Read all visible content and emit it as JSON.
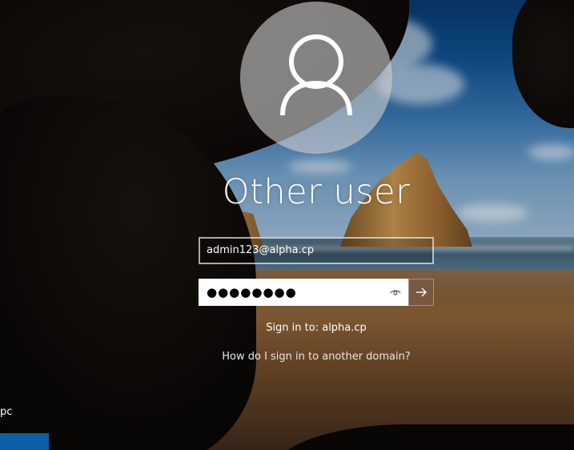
{
  "login": {
    "username": "Other user",
    "user_field_value": "admin123@alpha.cp",
    "password_mask": "●●●●●●●●",
    "sign_in_to": "Sign in to: alpha.cp",
    "domain_link": "How do I sign in to another domain?"
  },
  "corner": {
    "user_label": "pc"
  },
  "icons": {
    "avatar": "user-silhouette-icon",
    "reveal": "eye-icon",
    "submit": "arrow-right-icon"
  },
  "colors": {
    "tile": "#0b5ea8",
    "submit_bg": "#785a46",
    "avatar_bg": "#cdcdcd"
  }
}
